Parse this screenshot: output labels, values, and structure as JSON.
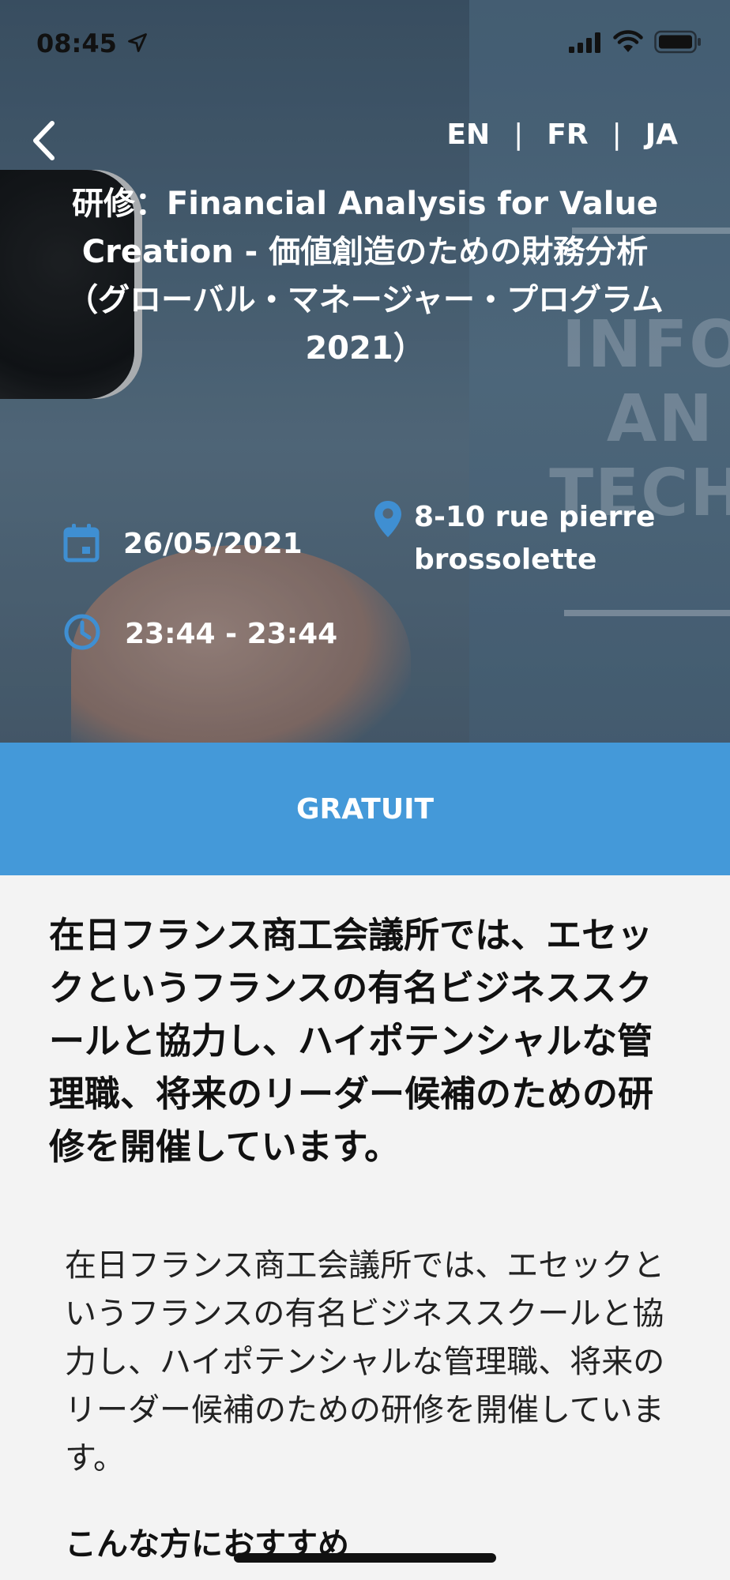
{
  "status_bar": {
    "time": "08:45"
  },
  "nav": {
    "languages": [
      "EN",
      "FR",
      "JA"
    ],
    "separator": "|"
  },
  "event": {
    "title": "研修：Financial Analysis for Value Creation - 価値創造のための財務分析（グローバル・マネージャー・プログラム 2021）",
    "date": "26/05/2021",
    "time_range": "23:44 - 23:44",
    "location": "8-10 rue pierre brossolette",
    "price": "GRATUIT"
  },
  "content": {
    "lead": "在日フランス商工会議所では、エセックというフランスの有名ビジネススクールと協力し、ハイポテンシャルな管理職、将来のリーダー候補のための研修を開催しています。",
    "body": "在日フランス商工会議所では、エセックというフランスの有名ビジネススクールと協力し、ハイポテンシャルな管理職、将来のリーダー候補のための研修を開催しています。",
    "subheading": "こんな方におすすめ"
  },
  "hero": {
    "background_sign": "INFO\nAN\nTECH"
  },
  "colors": {
    "accent": "#4499d9",
    "icon_blue": "#3f8fd2",
    "hero_text": "#ffffff",
    "page_bg": "#f3f3f3"
  },
  "icons": {
    "back": "chevron-left-icon",
    "date": "calendar-icon",
    "time": "clock-icon",
    "location": "map-pin-icon",
    "signal": "signal-icon",
    "wifi": "wifi-icon",
    "battery": "battery-icon",
    "location_arrow": "location-arrow-icon"
  }
}
